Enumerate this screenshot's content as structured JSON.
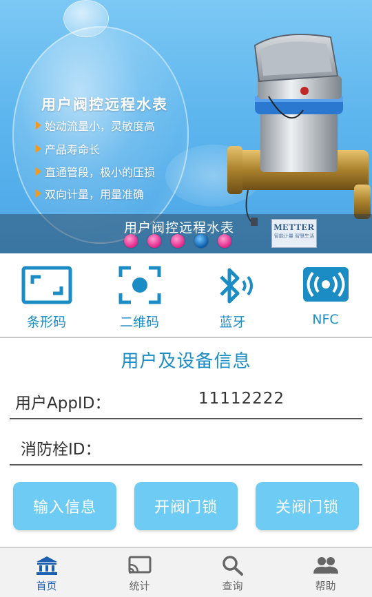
{
  "banner": {
    "title": "用户阀控远程水表",
    "features": [
      "始动流量小，灵敏度高",
      "产品寿命长",
      "直通管段，极小的压损",
      "双向计量，用量准确"
    ],
    "caption": "用户阀控远程水表",
    "carousel": {
      "count": 5,
      "active_index": 3
    },
    "logo": {
      "text": "METTER",
      "subtext": "智能计量 智慧生活"
    }
  },
  "scan_options": [
    {
      "label": "条形码",
      "icon": "barcode-frame-icon"
    },
    {
      "label": "二维码",
      "icon": "qrcode-scan-icon"
    },
    {
      "label": "蓝牙",
      "icon": "bluetooth-icon"
    },
    {
      "label": "NFC",
      "icon": "nfc-icon"
    }
  ],
  "info": {
    "title": "用户及设备信息",
    "appid_label": "用户AppID：",
    "appid_value": "11112222",
    "hydrant_label": "消防栓ID：",
    "hydrant_value": ""
  },
  "actions": {
    "input": "输入信息",
    "open": "开阀门锁",
    "close": "关阀门锁"
  },
  "nav": {
    "active": "home",
    "items": [
      {
        "key": "home",
        "label": "首页",
        "icon": "bank-home-icon"
      },
      {
        "key": "stats",
        "label": "统计",
        "icon": "cast-screen-icon"
      },
      {
        "key": "query",
        "label": "查询",
        "icon": "search-icon"
      },
      {
        "key": "help",
        "label": "帮助",
        "icon": "people-icon"
      }
    ]
  },
  "colors": {
    "accent": "#1b8dc4",
    "button": "#6ecbf4",
    "nav_active": "#1e5fb0",
    "carousel_dot": "#e0268a",
    "carousel_dot_active": "#0b5aa8"
  }
}
